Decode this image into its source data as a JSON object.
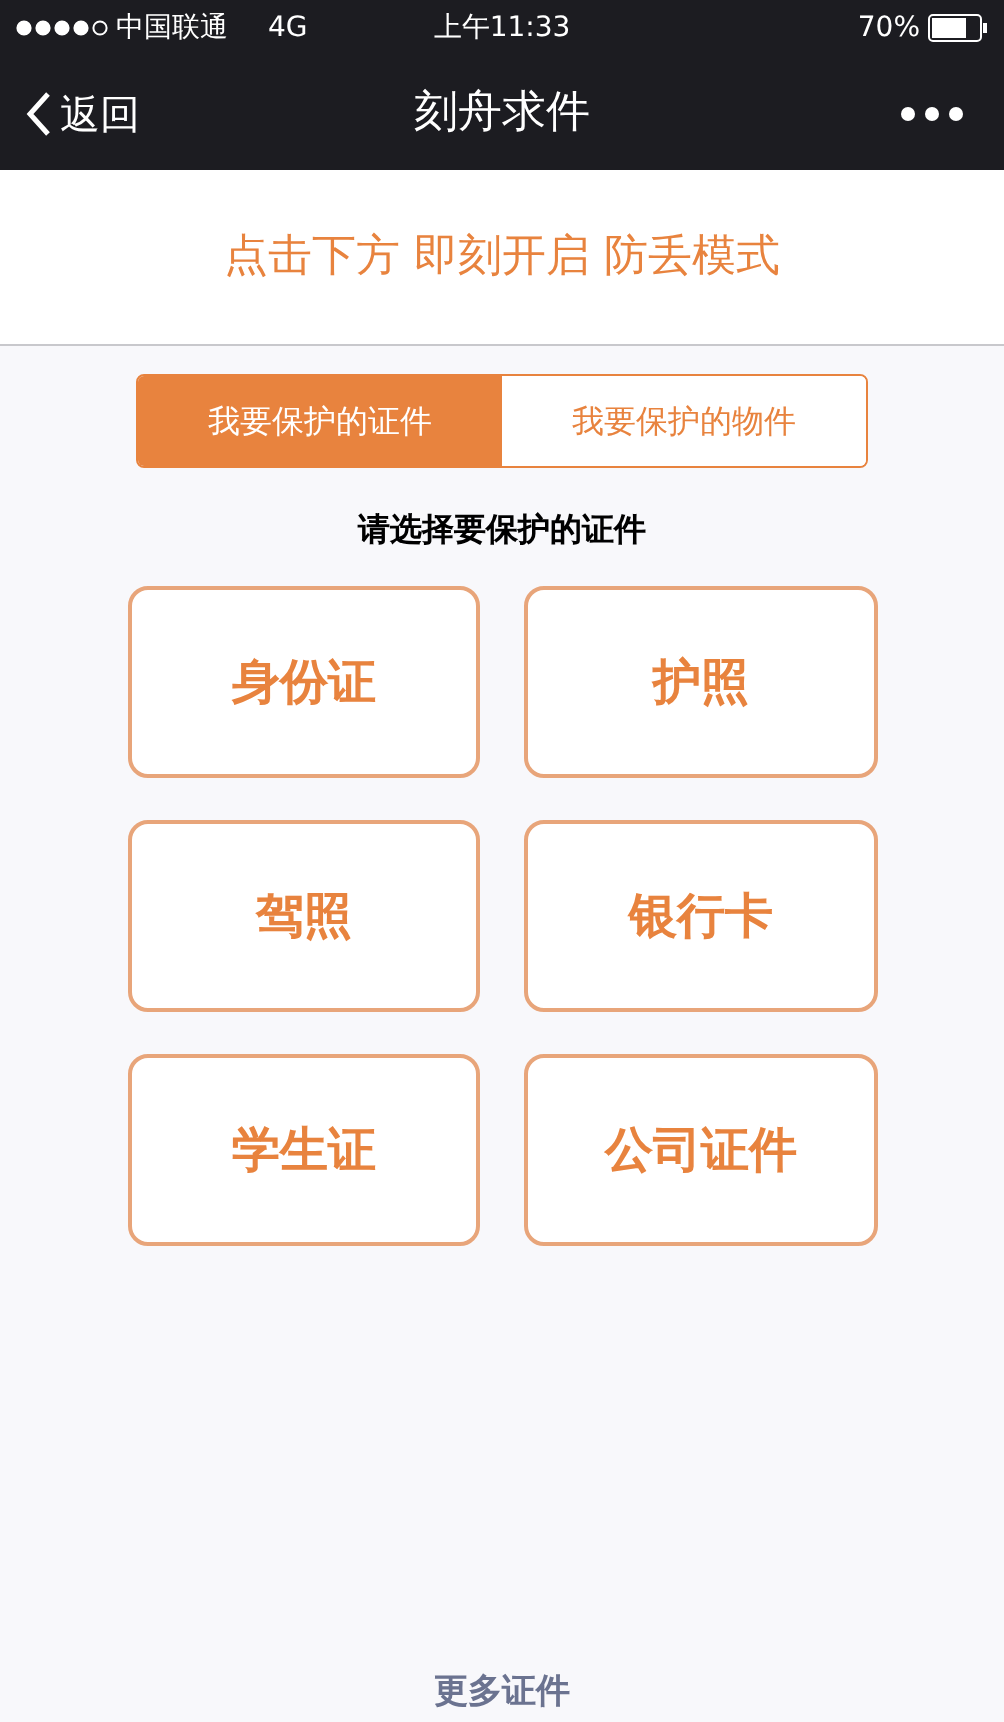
{
  "status_bar": {
    "carrier": "中国联通",
    "network": "4G",
    "time": "上午11:33",
    "battery": "70%"
  },
  "nav": {
    "back": "返回",
    "title": "刻舟求件"
  },
  "banner": "点击下方 即刻开启 防丢模式",
  "tabs": [
    {
      "label": "我要保护的证件",
      "selected": true
    },
    {
      "label": "我要保护的物件",
      "selected": false
    }
  ],
  "prompt": "请选择要保护的证件",
  "options": [
    "身份证",
    "护照",
    "驾照",
    "银行卡",
    "学生证",
    "公司证件"
  ],
  "more": "更多证件"
}
